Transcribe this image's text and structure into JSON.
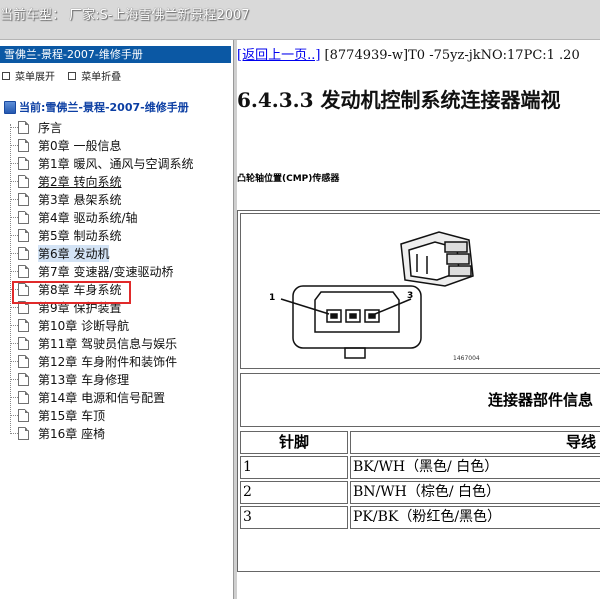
{
  "window": {
    "title": "当前车型：  厂家:S-上海雪佛兰新景程2007"
  },
  "sidebar": {
    "header": "雪佛兰-景程-2007-维修手册",
    "expand_all": "菜单展开",
    "collapse_all": "菜单折叠",
    "root": "当前:雪佛兰-景程-2007-维修手册",
    "items": [
      {
        "label": "序言"
      },
      {
        "label": "第0章  一般信息"
      },
      {
        "label": "第1章  暖风、通风与空调系统"
      },
      {
        "label": "第2章  转向系统"
      },
      {
        "label": "第3章  悬架系统"
      },
      {
        "label": "第4章  驱动系统/轴"
      },
      {
        "label": "第5章  制动系统"
      },
      {
        "label": "第6章  发动机"
      },
      {
        "label": "第7章  变速器/变速驱动桥"
      },
      {
        "label": "第8章  车身系统"
      },
      {
        "label": "第9章  保护装置"
      },
      {
        "label": "第10章  诊断导航"
      },
      {
        "label": "第11章  驾驶员信息与娱乐"
      },
      {
        "label": "第12章  车身附件和装饰件"
      },
      {
        "label": "第13章  车身修理"
      },
      {
        "label": "第14章  电源和信号配置"
      },
      {
        "label": "第15章  车顶"
      },
      {
        "label": "第16章  座椅"
      }
    ]
  },
  "content": {
    "back_link": "[返回上一页..]",
    "doc_ref": " [8774939-w]T0 -75yz-jkNO:17PC:1 .20",
    "section_title": "6.4.3.3 发动机控制系统连接器端视",
    "component_caption": "凸轮轴位置(CMP)传感器",
    "figure": {
      "callout_1": "1",
      "callout_3": "3",
      "figure_id": "1467004"
    },
    "info_title": "连接器部件信息",
    "table": {
      "headers": [
        "针脚",
        "导线"
      ],
      "rows": [
        [
          "1",
          "BK/WH（黑色/ 白色）"
        ],
        [
          "2",
          "BN/WH（棕色/ 白色）"
        ],
        [
          "3",
          "PK/BK（粉红色/黑色）"
        ]
      ]
    }
  }
}
